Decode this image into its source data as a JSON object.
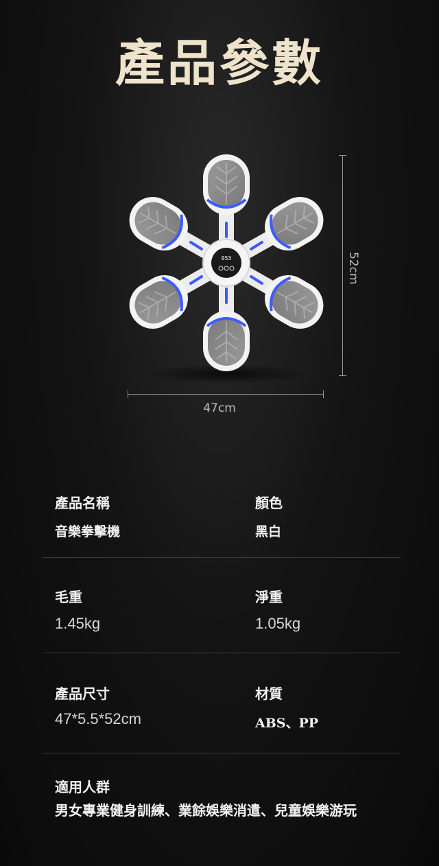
{
  "title": "產品參數",
  "dimensions": {
    "height": "52cm",
    "width": "47cm"
  },
  "specs": [
    {
      "left_label": "產品名稱",
      "left_value": "音樂拳擊機",
      "right_label": "顏色",
      "right_value": "黑白"
    },
    {
      "left_label": "毛重",
      "left_value": "1.45kg",
      "right_label": "淨重",
      "right_value": "1.05kg"
    },
    {
      "left_label": "產品尺寸",
      "left_value": "47*5.5*52cm",
      "right_label": "材質",
      "right_value": "ABS、PP"
    }
  ],
  "usage": {
    "label": "適用人群",
    "value": "男女專業健身訓練、業餘娛樂消遣、兒童娛樂游玩"
  },
  "display_readout": "053",
  "colors": {
    "accent_blue": "#3b5cff",
    "title_gold": "#efe3cc",
    "pad_grey": "#8e8e8e"
  }
}
